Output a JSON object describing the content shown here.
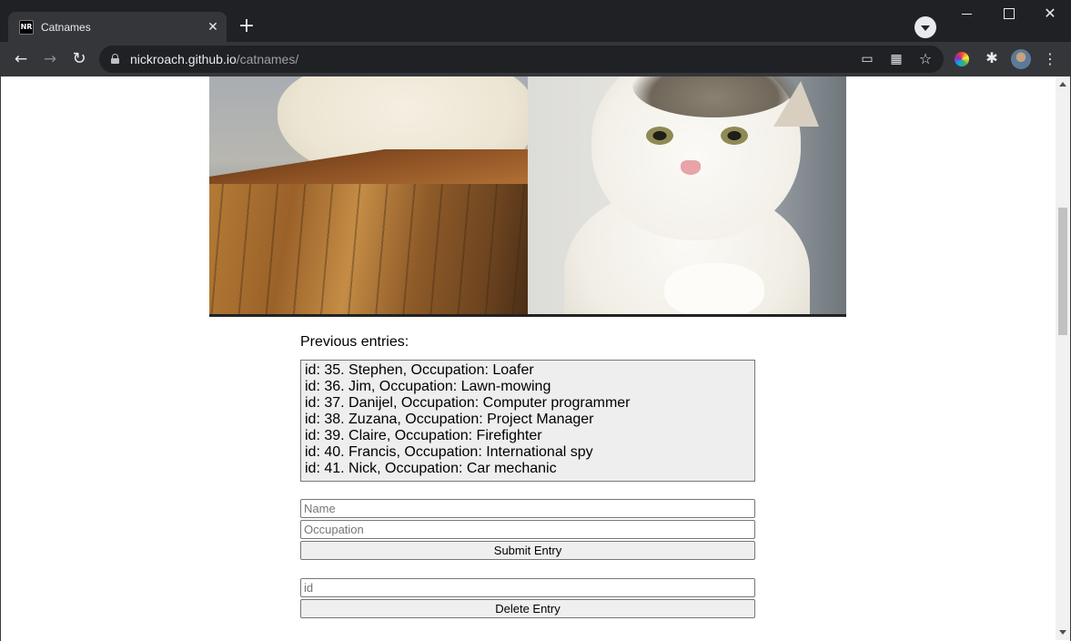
{
  "browser": {
    "tab": {
      "favicon_text": "NR",
      "title": "Catnames",
      "close_glyph": "✕"
    },
    "new_tab_glyph": "+",
    "nav": {
      "back_glyph": "←",
      "forward_glyph": "→",
      "reload_glyph": "↻"
    },
    "url": {
      "host": "nickroach.github.io",
      "path": "/catnames/"
    },
    "icons": [
      "lock-icon",
      "cast-icon",
      "qr-code-icon",
      "bookmark-star-icon",
      "color-wheel-extension-icon",
      "extensions-puzzle-icon",
      "profile-avatar",
      "more-menu-icon"
    ],
    "window_controls": [
      "minimize",
      "maximize",
      "close"
    ]
  },
  "page": {
    "image_semantic": "two-panel cat meme image (cat on wooden crate, smug white cat)",
    "previous_entries_label": "Previous entries:",
    "entries": [
      "id: 35. Stephen, Occupation: Loafer",
      "id: 36. Jim, Occupation: Lawn-mowing",
      "id: 37. Danijel, Occupation: Computer programmer",
      "id: 38. Zuzana, Occupation: Project Manager",
      "id: 39. Claire, Occupation: Firefighter",
      "id: 40. Francis, Occupation: International spy",
      "id: 41. Nick, Occupation: Car mechanic"
    ],
    "form": {
      "name_placeholder": "Name",
      "occupation_placeholder": "Occupation",
      "submit_label": "Submit Entry",
      "id_placeholder": "id",
      "delete_label": "Delete Entry"
    }
  },
  "colors": {
    "tabstrip_bg": "#202124",
    "toolbar_bg": "#35363a",
    "entries_bg": "#eeeeee",
    "button_bg": "#efefef"
  }
}
